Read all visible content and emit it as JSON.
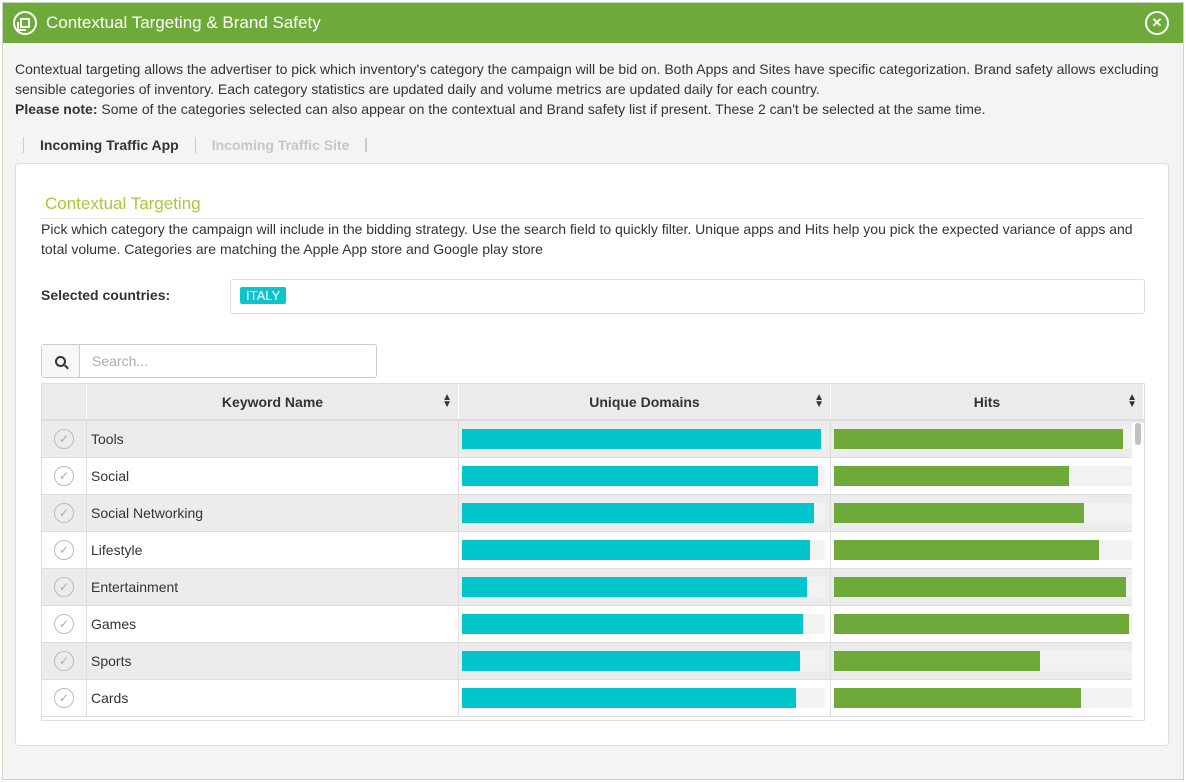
{
  "panel": {
    "title": "Contextual Targeting & Brand Safety",
    "close_icon": "collapse-icon"
  },
  "intro": {
    "text": "Contextual targeting allows the advertiser to pick which inventory's category the campaign will be bid on. Both Apps and Sites have specific categorization. Brand safety allows excluding sensible categories of inventory. Each category statistics are updated daily and volume metrics are updated daily for each country.",
    "note_label": "Please note:",
    "note_text": " Some of the categories selected can also appear on the contextual and Brand safety list if present. These 2 can't be selected at the same time."
  },
  "tabs": [
    {
      "label": "Incoming Traffic App",
      "active": true
    },
    {
      "label": "Incoming Traffic Site",
      "active": false
    }
  ],
  "section": {
    "title": "Contextual Targeting",
    "description": "Pick which category the campaign will include in the bidding strategy. Use the search field to quickly filter. Unique apps and Hits help you pick the expected variance of apps and total volume. Categories are matching the Apple App store and Google play store"
  },
  "countries": {
    "label": "Selected countries:",
    "selected": [
      "ITALY"
    ]
  },
  "search": {
    "placeholder": "Search..."
  },
  "table": {
    "columns": [
      "Keyword Name",
      "Unique Domains",
      "Hits"
    ],
    "colors": {
      "domains": "#02c6cc",
      "hits": "#6eaa3a"
    },
    "rows": [
      {
        "name": "Tools",
        "domains": 0.99,
        "hits": 0.97
      },
      {
        "name": "Social",
        "domains": 0.98,
        "hits": 0.79
      },
      {
        "name": "Social Networking",
        "domains": 0.97,
        "hits": 0.84
      },
      {
        "name": "Lifestyle",
        "domains": 0.96,
        "hits": 0.89
      },
      {
        "name": "Entertainment",
        "domains": 0.95,
        "hits": 0.98
      },
      {
        "name": "Games",
        "domains": 0.94,
        "hits": 0.99
      },
      {
        "name": "Sports",
        "domains": 0.93,
        "hits": 0.69
      },
      {
        "name": "Cards",
        "domains": 0.92,
        "hits": 0.83
      }
    ]
  }
}
